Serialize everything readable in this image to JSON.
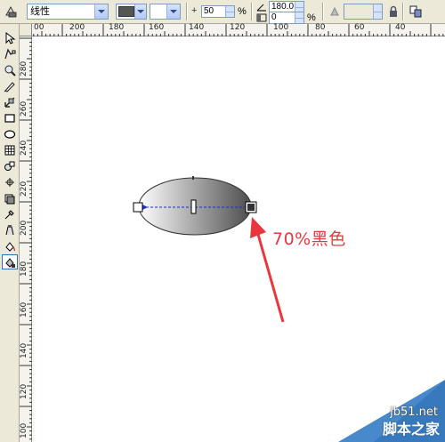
{
  "property_bar": {
    "fill_type_value": "线性",
    "offset_value": "50",
    "offset_unit": "%",
    "angle_value": "180.0",
    "edge_pad_value": "0",
    "edge_pad_unit": "%",
    "color_swatch": "#555555"
  },
  "toolbox": {
    "tools": [
      {
        "name": "pick-tool-icon"
      },
      {
        "name": "shape-tool-icon"
      },
      {
        "name": "zoom-tool-icon"
      },
      {
        "name": "freehand-tool-icon"
      },
      {
        "name": "smart-fill-tool-icon"
      },
      {
        "name": "rectangle-tool-icon"
      },
      {
        "name": "ellipse-tool-icon"
      },
      {
        "name": "polygon-tool-icon"
      },
      {
        "name": "basic-shapes-tool-icon"
      },
      {
        "name": "text-tool-icon"
      },
      {
        "name": "interactive-blend-tool-icon"
      },
      {
        "name": "eyedropper-tool-icon"
      },
      {
        "name": "outline-tool-icon"
      },
      {
        "name": "fill-tool-icon"
      },
      {
        "name": "interactive-fill-tool-icon"
      }
    ]
  },
  "ruler_top": {
    "labels": [
      "00",
      "200",
      "180",
      "160",
      "140",
      "120",
      "100",
      "80",
      "60",
      "40"
    ]
  },
  "ruler_left": {
    "labels": [
      "280",
      "260",
      "240",
      "220",
      "200",
      "180",
      "160",
      "140",
      "120",
      "100"
    ]
  },
  "canvas": {
    "annotation": "70%黑色",
    "gradient_start_color": "#ffffff",
    "gradient_end_color": "#4d4d4d",
    "arrow_color": "#e8383d"
  },
  "watermark": {
    "url": "jb51.net",
    "site_name": "脚本之家"
  }
}
